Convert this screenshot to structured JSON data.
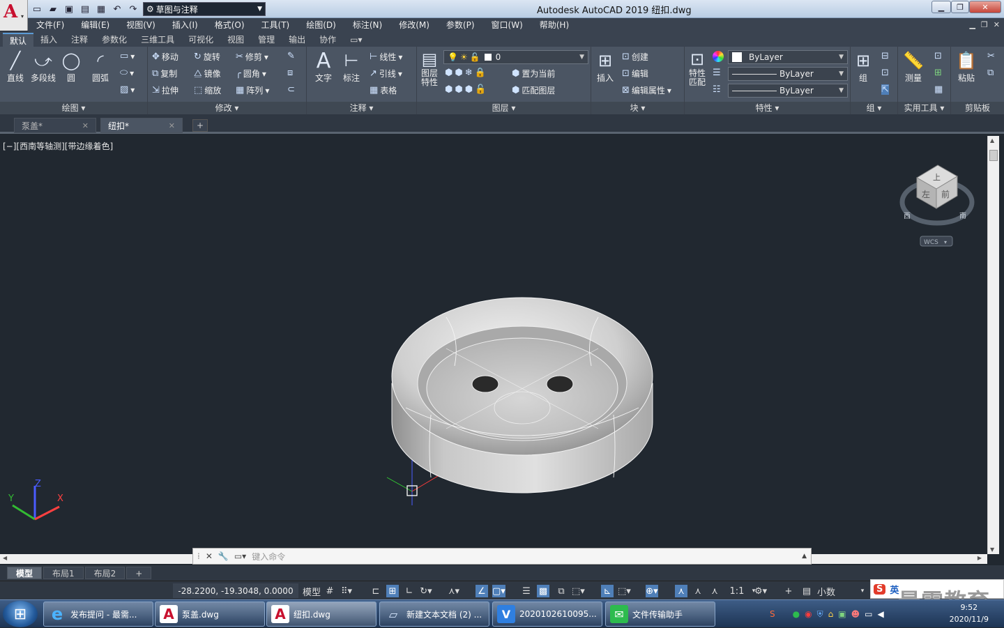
{
  "app": {
    "logo_letter": "A",
    "title": "Autodesk AutoCAD 2019    纽扣.dwg"
  },
  "quick_access": {
    "workspace": "草图与注释"
  },
  "menus": [
    "文件(F)",
    "编辑(E)",
    "视图(V)",
    "插入(I)",
    "格式(O)",
    "工具(T)",
    "绘图(D)",
    "标注(N)",
    "修改(M)",
    "参数(P)",
    "窗口(W)",
    "帮助(H)"
  ],
  "ribbon_tabs": [
    "默认",
    "插入",
    "注释",
    "参数化",
    "三维工具",
    "可视化",
    "视图",
    "管理",
    "输出",
    "协作"
  ],
  "ribbon": {
    "draw": {
      "title": "绘图 ▾",
      "line": "直线",
      "polyline": "多段线",
      "circle": "圆",
      "arc": "圆弧"
    },
    "modify": {
      "title": "修改 ▾",
      "move": "移动",
      "rotate": "旋转",
      "trim": "修剪",
      "copy": "复制",
      "mirror": "镜像",
      "fillet": "圆角",
      "stretch": "拉伸",
      "scale": "缩放",
      "array": "阵列"
    },
    "annotation": {
      "title": "注释 ▾",
      "text": "文字",
      "dimension": "标注",
      "linear": "线性",
      "leader": "引线",
      "table": "表格"
    },
    "layers": {
      "title": "图层 ▾",
      "layer_props": "图层\n特性",
      "current_layer": "0",
      "set_current": "置为当前",
      "match_layer": "匹配图层"
    },
    "block": {
      "title": "块 ▾",
      "insert": "插入",
      "create": "创建",
      "edit": "编辑",
      "edit_attr": "编辑属性"
    },
    "properties": {
      "title": "特性 ▾",
      "match": "特性\n匹配",
      "color": "ByLayer",
      "linetype": "ByLayer",
      "lineweight": "ByLayer"
    },
    "groups": {
      "title": "组 ▾",
      "group": "组"
    },
    "utilities": {
      "title": "实用工具 ▾",
      "measure": "测量"
    },
    "clipboard": {
      "title": "剪贴板",
      "paste": "粘贴"
    }
  },
  "doc_tabs": [
    {
      "name": "泵盖*"
    },
    {
      "name": "纽扣*"
    }
  ],
  "viewport": {
    "label": "[−][西南等轴测][带边缘着色]",
    "viewcube_top": "上",
    "viewcube_left": "左",
    "viewcube_front": "前",
    "compass_w": "西",
    "compass_s": "南",
    "wcs": "WCS",
    "ucs_x": "X",
    "ucs_y": "Y",
    "ucs_z": "Z"
  },
  "command": {
    "placeholder": "键入命令"
  },
  "layout_tabs": [
    "模型",
    "布局1",
    "布局2"
  ],
  "status": {
    "coords": "-28.2200, -19.3048, 0.0000",
    "model": "模型",
    "scale": "1:1",
    "units": "小数"
  },
  "ime": {
    "label": "英"
  },
  "taskbar": {
    "items": [
      {
        "label": "发布提问 - 最需..."
      },
      {
        "label": "泵盖.dwg"
      },
      {
        "label": "纽扣.dwg"
      },
      {
        "label": "新建文本文档 (2) ..."
      },
      {
        "label": "2020102610095..."
      },
      {
        "label": "文件传输助手"
      }
    ],
    "time": "9:52",
    "date": "2020/11/9"
  },
  "watermark": "最需教育",
  "colors": {
    "accent": "#5b9bd5",
    "ribbon_bg": "#4b5563",
    "viewport_bg": "#212830",
    "autocad_red": "#c8102e"
  }
}
